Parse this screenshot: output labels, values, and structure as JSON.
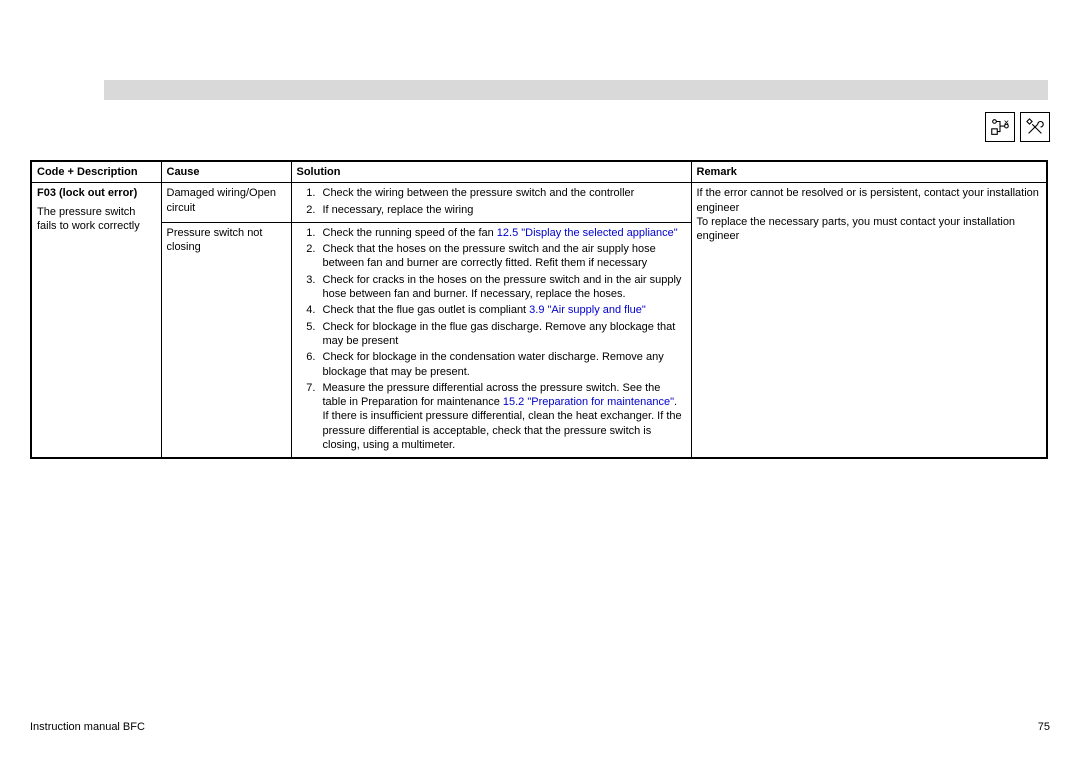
{
  "table": {
    "headers": {
      "code": "Code + Description",
      "cause": "Cause",
      "solution": "Solution",
      "remark": "Remark"
    },
    "code_title": "F03 (lock out error)",
    "code_desc": "The pressure switch fails to work correctly",
    "cause1": "Damaged wiring/Open circuit",
    "cause2": "Pressure switch not closing",
    "sol1_1": "Check the wiring between the pressure switch and the controller",
    "sol1_2": "If necessary, replace the wiring",
    "sol2_1a": "Check the running speed of the fan ",
    "sol2_1b": "12.5 \"Display the selected appliance\"",
    "sol2_2": "Check that the hoses on the pressure switch and the air supply hose between fan and burner are correctly fitted. Refit them if necessary",
    "sol2_3": "Check for cracks in the hoses on the pressure switch and in the air supply hose between fan and burner. If necessary, replace the hoses.",
    "sol2_4a": "Check that the flue gas outlet is compliant ",
    "sol2_4b": "3.9 \"Air supply and flue\"",
    "sol2_5": "Check for blockage in the flue gas discharge. Remove any blockage that may be present",
    "sol2_6": "Check for blockage in the condensation water discharge. Remove any blockage that may be present.",
    "sol2_7a": "Measure the pressure differential across the pressure switch. See the table in Preparation for maintenance ",
    "sol2_7b": "15.2 \"Preparation for maintenance\"",
    "sol2_7c": ". If there is insufficient pressure differential, clean the heat exchanger. If the pressure differential is acceptable, check that the pressure switch is closing, using a multimeter.",
    "remark1": "If the error cannot be resolved or is persistent, contact your installation engineer",
    "remark2": "To replace the necessary parts, you must contact your installation engineer"
  },
  "footer": {
    "left": "Instruction manual BFC",
    "right": "75"
  }
}
